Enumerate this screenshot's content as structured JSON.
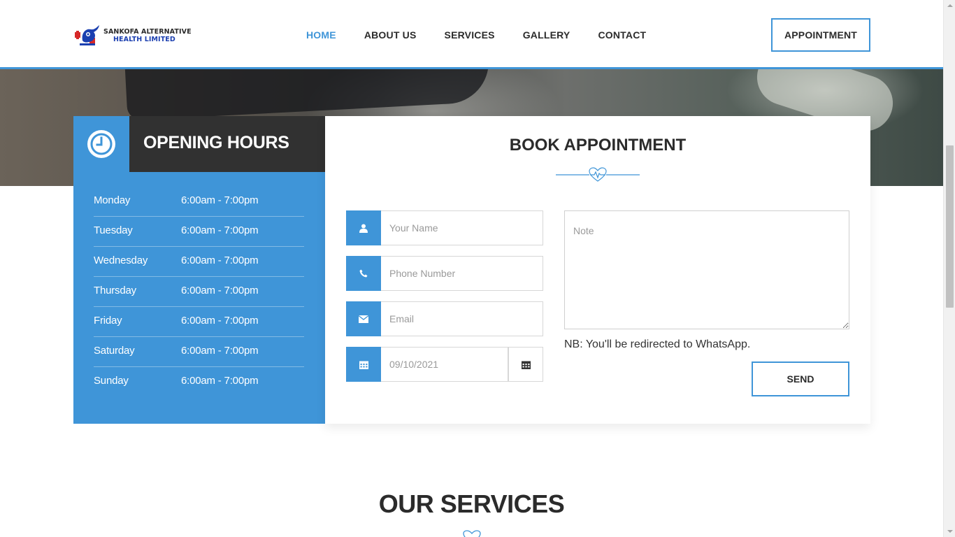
{
  "brand": {
    "line1": "SANKOFA ALTERNATIVE",
    "line2": "HEALTH LIMITED",
    "accent": "#3f95d8"
  },
  "nav": {
    "items": [
      {
        "label": "HOME"
      },
      {
        "label": "ABOUT US"
      },
      {
        "label": "SERVICES"
      },
      {
        "label": "GALLERY"
      },
      {
        "label": "CONTACT"
      }
    ],
    "active": "HOME",
    "appointment_label": "APPOINTMENT"
  },
  "opening_hours": {
    "title": "OPENING HOURS",
    "icon": "clock-icon",
    "rows": [
      {
        "day": "Monday",
        "time": "6:00am - 7:00pm"
      },
      {
        "day": "Tuesday",
        "time": "6:00am - 7:00pm"
      },
      {
        "day": "Wednesday",
        "time": "6:00am - 7:00pm"
      },
      {
        "day": "Thursday",
        "time": "6:00am - 7:00pm"
      },
      {
        "day": "Friday",
        "time": "6:00am - 7:00pm"
      },
      {
        "day": "Saturday",
        "time": "6:00am - 7:00pm"
      },
      {
        "day": "Sunday",
        "time": "6:00am - 7:00pm"
      }
    ]
  },
  "booking": {
    "title": "BOOK APPOINTMENT",
    "name_placeholder": "Your Name",
    "phone_placeholder": "Phone Number",
    "email_placeholder": "Email",
    "date_value": "09/10/2021",
    "note_placeholder": "Note",
    "nb_text": "NB: You'll be redirected to WhatsApp.",
    "send_label": "SEND"
  },
  "services": {
    "title": "OUR SERVICES"
  }
}
